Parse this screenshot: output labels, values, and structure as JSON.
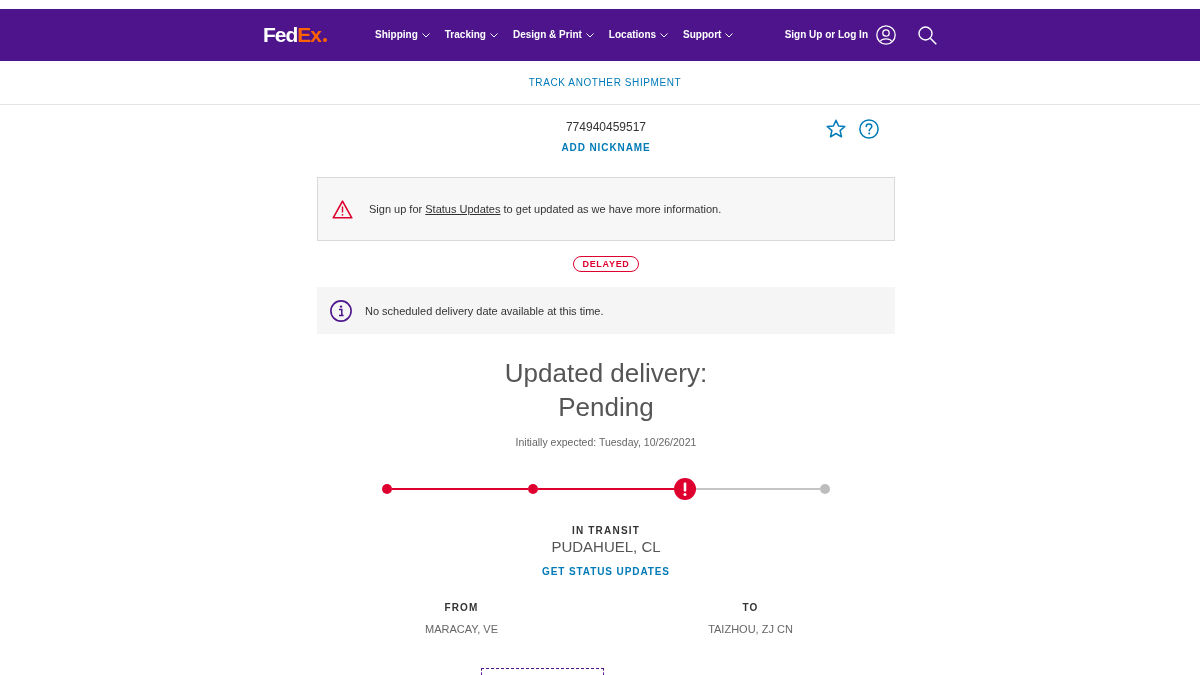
{
  "header": {
    "logo": [
      "Fed",
      "Ex"
    ],
    "nav": [
      {
        "label": "Shipping"
      },
      {
        "label": "Tracking"
      },
      {
        "label": "Design & Print"
      },
      {
        "label": "Locations"
      },
      {
        "label": "Support"
      }
    ],
    "account_link": "Sign Up or Log In"
  },
  "subnav": {
    "link": "TRACK ANOTHER SHIPMENT"
  },
  "shipment": {
    "tracking_number": "774940459517",
    "nickname_link": "ADD NICKNAME"
  },
  "alert": {
    "text_before": "Sign up for",
    "link": "Status Updates",
    "text_after": "to get updated as we have more information."
  },
  "status_badge": "DELAYED",
  "info": {
    "message": "No scheduled delivery date available at this time."
  },
  "delivery": {
    "heading": "Updated delivery:",
    "value": "Pending",
    "initially_expected": "Initially expected: Tuesday, 10/26/2021"
  },
  "progress": {
    "steps": [
      {
        "kind": "done"
      },
      {
        "kind": "done"
      },
      {
        "kind": "exception"
      },
      {
        "kind": "pending"
      }
    ]
  },
  "status": {
    "label": "IN TRANSIT",
    "location": "PUDAHUEL, CL",
    "link": "GET STATUS UPDATES"
  },
  "route": [
    {
      "label": "FROM",
      "place": "MARACAY, VE"
    },
    {
      "label": "TO",
      "place": "TAIZHOU, ZJ CN"
    }
  ]
}
